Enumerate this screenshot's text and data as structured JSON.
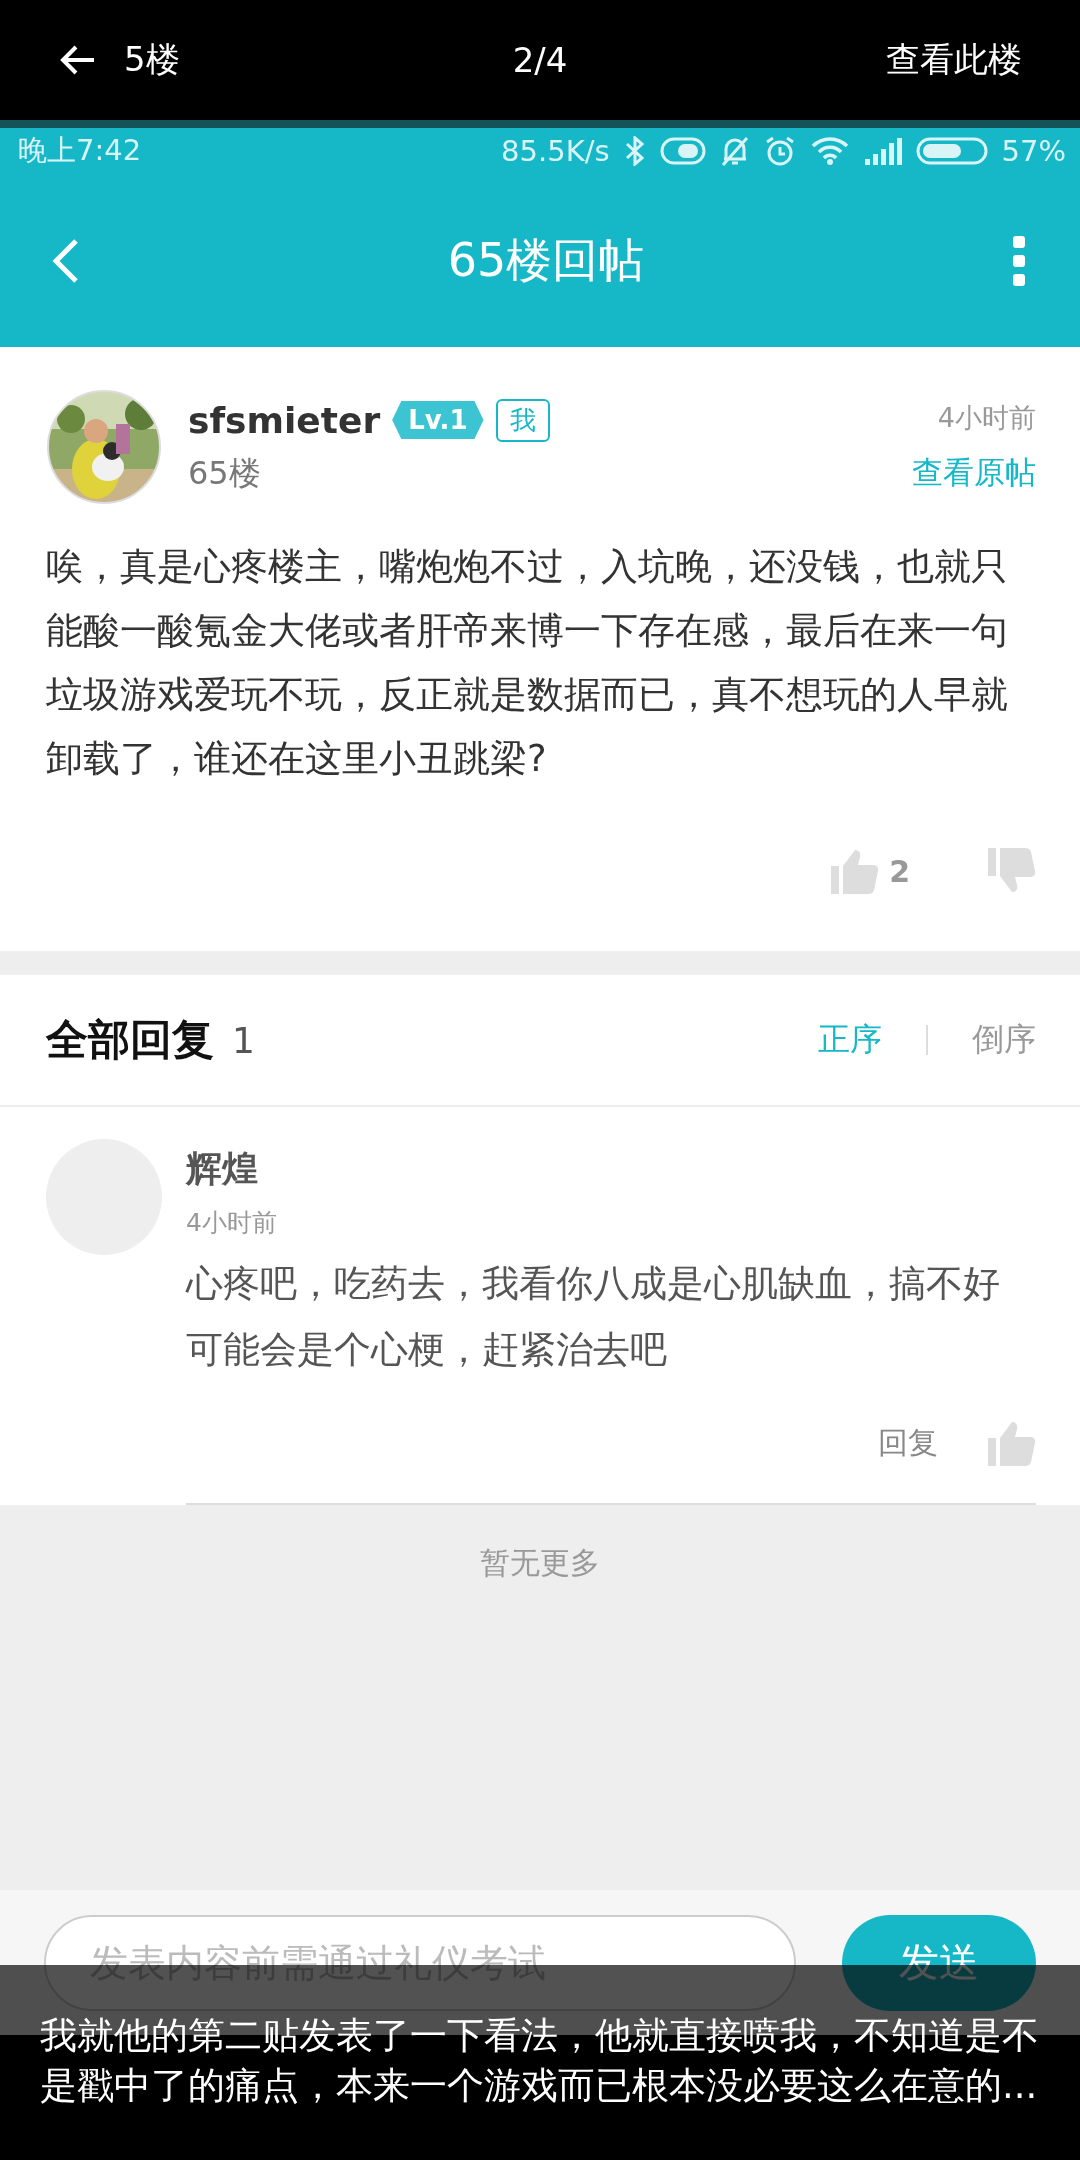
{
  "viewer": {
    "back_label": "5楼",
    "counter": "2/4",
    "action": "查看此楼"
  },
  "status_bar": {
    "time": "晚上7:42",
    "speed": "85.5K/s",
    "battery": "57%"
  },
  "header": {
    "title": "65楼回帖"
  },
  "post": {
    "author": "sfsmieter",
    "level_badge": "Lv.1",
    "me_badge": "我",
    "floor": "65楼",
    "time": "4小时前",
    "view_original": "查看原帖",
    "body": "唉，真是心疼楼主，嘴炮炮不过，入坑晚，还没钱，也就只能酸一酸氪金大佬或者肝帝来博一下存在感，最后在来一句垃圾游戏爱玩不玩，反正就是数据而已，真不想玩的人早就卸载了，谁还在这里小丑跳梁?",
    "likes": "2"
  },
  "replies": {
    "title": "全部回复",
    "count": "1",
    "sort": [
      {
        "label": "正序",
        "selected": true
      },
      {
        "label": "倒序",
        "selected": false
      }
    ],
    "items": [
      {
        "name": "辉煌",
        "time": "4小时前",
        "text": "心疼吧，吃药去，我看你八成是心肌缺血，搞不好可能会是个心梗，赶紧治去吧",
        "reply": "回复"
      }
    ],
    "end_note": "暂无更多"
  },
  "composer": {
    "placeholder": "发表内容前需通过礼仪考试",
    "send": "发送"
  },
  "caption": "我就他的第二贴发表了一下看法，他就直接喷我，不知道是不是戳中了的痛点，本来一个游戏而已根本没必要这么在意的..."
}
